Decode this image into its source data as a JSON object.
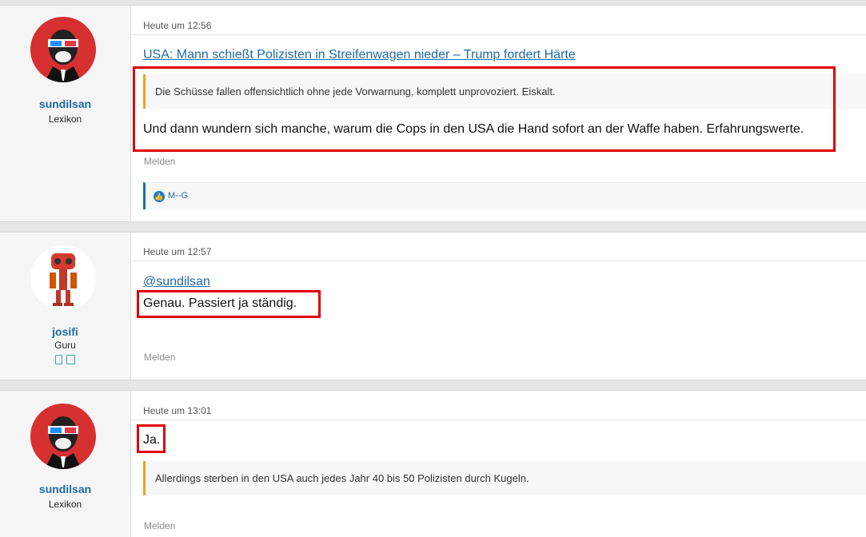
{
  "posts": [
    {
      "username": "sundilsan",
      "rank": "Lexikon",
      "timestamp": "Heute um 12:56",
      "link_text": "USA: Mann schießt Polizisten in Streifenwagen nieder – Trump fordert Härte",
      "quote": "Die Schüsse fallen offensichtlich ohne jede Vorwarnung, komplett unprovoziert. Eiskalt.",
      "body": "Und dann wundern sich manche, warum die Cops in den USA die Hand sofort an der Waffe haben. Erfahrungswerte.",
      "report_label": "Melden",
      "like_user": "M--G",
      "avatar_icon": "monkey-3d-glasses-avatar"
    },
    {
      "username": "josifi",
      "rank": "Guru",
      "timestamp": "Heute um 12:57",
      "mention": "@sundilsan",
      "body": "Genau. Passiert ja ständig.",
      "report_label": "Melden",
      "avatar_icon": "red-robot-avatar",
      "device_icons": [
        "phone-icon",
        "tablet-icon"
      ]
    },
    {
      "username": "sundilsan",
      "rank": "Lexikon",
      "timestamp": "Heute um 13:01",
      "body": "Ja.",
      "quote": "Allerdings sterben in den USA auch jedes Jahr 40 bis 50 Polizisten durch Kugeln.",
      "report_label": "Melden",
      "avatar_icon": "monkey-3d-glasses-avatar"
    }
  ],
  "colors": {
    "username": "#1e6aa6",
    "highlight_border": "#e00000",
    "quote_accent": "#f0a020"
  }
}
